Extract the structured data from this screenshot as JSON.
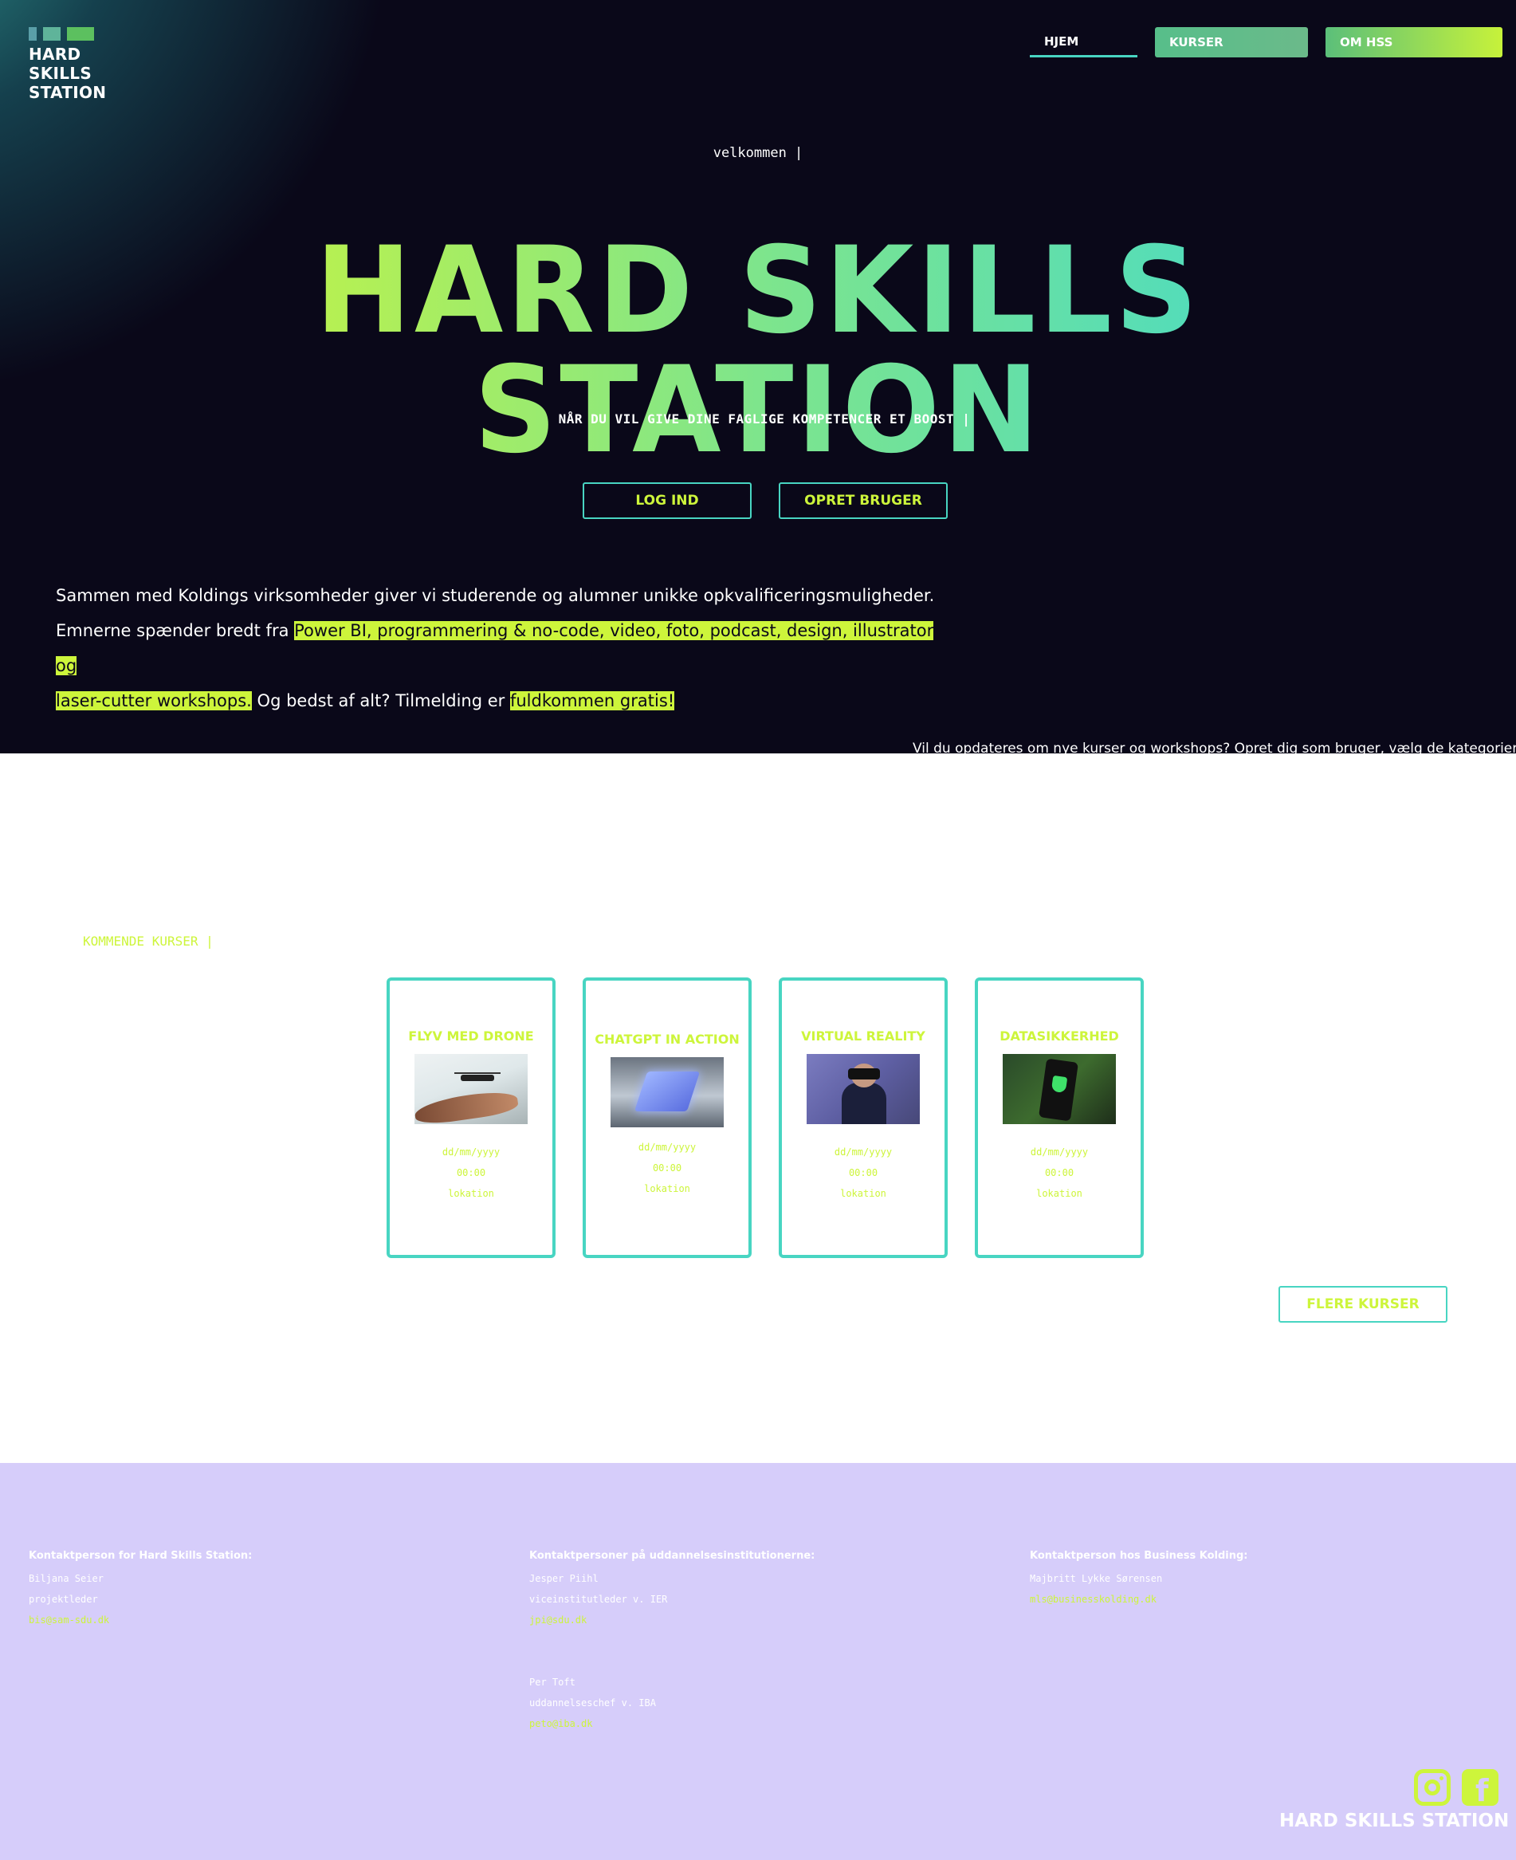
{
  "logo": {
    "line1": "HARD",
    "line2": "SKILLS",
    "line3": "STATION"
  },
  "nav": [
    {
      "label": "HJEM"
    },
    {
      "label": "KURSER"
    },
    {
      "label": "OM HSS"
    }
  ],
  "hero": {
    "welcome": "velkommen |",
    "title": "HARD SKILLS STATION",
    "subtitle": "NÅR DU VIL GIVE DINE FAGLIGE KOMPETENCER ET BOOST |",
    "login_label": "LOG IND",
    "signup_label": "OPRET BRUGER",
    "intro_line1": "Sammen med Koldings virksomheder giver vi studerende og alumner unikke opkvalificeringsmuligheder.",
    "intro_line2_prefix": "Emnerne spænder bredt fra ",
    "intro_line2_highlight": "Power BI, programmering & no-code, video, foto, podcast, design, illustrator og",
    "intro_line3_highlight": "laser-cutter workshops.",
    "intro_line3_middle": " Og bedst af alt? Tilmelding er ",
    "intro_line3_highlight2": "fuldkommen gratis!",
    "overflow_text": "Vil du opdateres om nye kurser og workshops? Opret dig som bruger, vælg de kategorier der"
  },
  "courses": {
    "section_label": "KOMMENDE KURSER |",
    "cards": [
      {
        "title": "FLYV MED DRONE",
        "date": "dd/mm/yyyy",
        "time": "00:00",
        "location": "lokation",
        "image": "drone-image"
      },
      {
        "title": "CHATGPT IN ACTION",
        "date": "dd/mm/yyyy",
        "time": "00:00",
        "location": "lokation",
        "image": "ai-chip-image"
      },
      {
        "title": "VIRTUAL REALITY",
        "date": "dd/mm/yyyy",
        "time": "00:00",
        "location": "lokation",
        "image": "vr-headset-image"
      },
      {
        "title": "DATASIKKERHED",
        "date": "dd/mm/yyyy",
        "time": "00:00",
        "location": "lokation",
        "image": "phone-security-image"
      }
    ],
    "more_label": "FLERE KURSER"
  },
  "footer": {
    "col1": {
      "heading": "Kontaktperson for Hard Skills Station:",
      "name": "Biljana Seier",
      "role": "projektleder",
      "email": "bis@sam-sdu.dk"
    },
    "col2": {
      "heading": "Kontaktpersoner på uddannelsesinstitutionerne:",
      "name1": "Jesper Piihl",
      "role1": "viceinstitutleder v. IER",
      "email1": "jpi@sdu.dk",
      "name2": "Per Toft",
      "role2": "uddannelseschef v. IBA",
      "email2": "peto@iba.dk"
    },
    "col3": {
      "heading": "Kontaktperson hos Business Kolding:",
      "name": "Majbritt Lykke Sørensen",
      "email": "mls@businesskolding.dk"
    },
    "brand": "HARD SKILLS STATION",
    "social": [
      "instagram-icon",
      "facebook-icon"
    ]
  },
  "colors": {
    "accent_lime": "#cdf53b",
    "accent_teal": "#48d5c2",
    "hero_bg": "#0a0819",
    "footer_bg": "#d6cdfa"
  }
}
